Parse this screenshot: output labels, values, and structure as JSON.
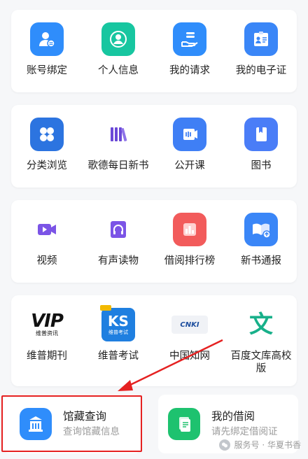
{
  "rows": [
    {
      "items": [
        {
          "label": "账号绑定",
          "icon": "user-bind-icon",
          "color": "#2f8dfb"
        },
        {
          "label": "个人信息",
          "icon": "profile-icon",
          "color": "#17c6a0"
        },
        {
          "label": "我的请求",
          "icon": "hand-request-icon",
          "color": "#2f8dfb"
        },
        {
          "label": "我的电子证",
          "icon": "id-card-icon",
          "color": "#3a86f7"
        }
      ]
    },
    {
      "items": [
        {
          "label": "分类浏览",
          "icon": "category-icon",
          "color": "#2c74e0"
        },
        {
          "label": "歌德每日新书",
          "icon": "books-icon",
          "color": "#6a48d7"
        },
        {
          "label": "公开课",
          "icon": "open-course-icon",
          "color": "#3f7ff5"
        },
        {
          "label": "图书",
          "icon": "book-icon",
          "color": "#4a7df7"
        }
      ]
    },
    {
      "items": [
        {
          "label": "视频",
          "icon": "video-icon",
          "color": "#7b54e6"
        },
        {
          "label": "有声读物",
          "icon": "audiobook-icon",
          "color": "#7b54e6"
        },
        {
          "label": "借阅排行榜",
          "icon": "ranking-icon",
          "color": "#f25b5b"
        },
        {
          "label": "新书通报",
          "icon": "new-book-icon",
          "color": "#3a86f7"
        }
      ]
    },
    {
      "items": [
        {
          "label": "维普期刊",
          "icon": "vip-logo-icon",
          "logo_text": "VIP",
          "logo_sub": "维普资讯"
        },
        {
          "label": "维普考试",
          "icon": "ks-logo-icon",
          "logo_text": "KS",
          "logo_sub": "维普考试"
        },
        {
          "label": "中国知网",
          "icon": "cnki-logo-icon",
          "logo_text": "CNKI"
        },
        {
          "label": "百度文库高校版",
          "icon": "baidu-wenku-icon",
          "logo_text": "文"
        }
      ]
    }
  ],
  "bottom": {
    "collection": {
      "title": "馆藏查询",
      "subtitle": "查询馆藏信息",
      "icon": "library-building-icon",
      "color": "#2f8dfb"
    },
    "borrow": {
      "title": "我的借阅",
      "subtitle": "请先绑定借阅证",
      "icon": "borrow-doc-icon",
      "color": "#1ec26f"
    }
  },
  "watermark": "服务号 · 华夏书香",
  "annotation_color": "#e52121"
}
